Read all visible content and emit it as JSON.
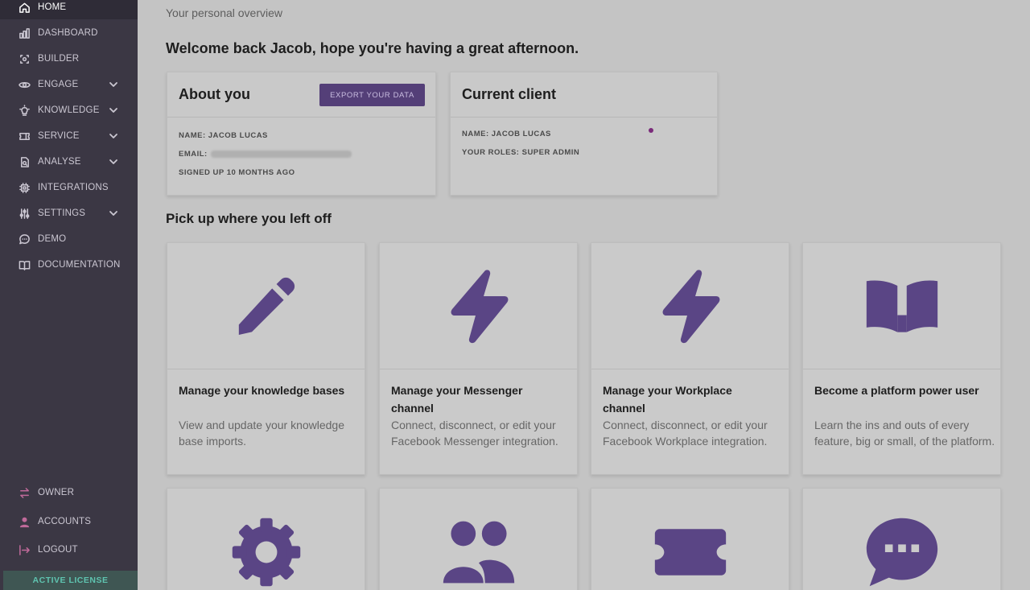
{
  "sidebar": {
    "items": [
      {
        "label": "HOME",
        "icon": "home-icon",
        "active": true
      },
      {
        "label": "DASHBOARD",
        "icon": "bar-chart-icon"
      },
      {
        "label": "BUILDER",
        "icon": "builder-icon"
      },
      {
        "label": "ENGAGE",
        "icon": "eye-icon",
        "expandable": true
      },
      {
        "label": "KNOWLEDGE",
        "icon": "lightbulb-icon",
        "expandable": true
      },
      {
        "label": "SERVICE",
        "icon": "ticket-icon",
        "expandable": true
      },
      {
        "label": "ANALYSE",
        "icon": "analyse-icon",
        "expandable": true
      },
      {
        "label": "INTEGRATIONS",
        "icon": "chip-icon"
      },
      {
        "label": "SETTINGS",
        "icon": "sliders-icon",
        "expandable": true
      },
      {
        "label": "DEMO",
        "icon": "chat-icon"
      },
      {
        "label": "DOCUMENTATION",
        "icon": "book-icon"
      }
    ],
    "bottom_items": [
      {
        "label": "OWNER",
        "icon": "swap-icon"
      },
      {
        "label": "ACCOUNTS",
        "icon": "user-icon"
      },
      {
        "label": "LOGOUT",
        "icon": "logout-icon"
      }
    ],
    "license": "ACTIVE LICENSE"
  },
  "main": {
    "subtitle": "Your personal overview",
    "welcome": "Welcome back Jacob, hope you're having a great afternoon.",
    "about": {
      "title": "About you",
      "export_label": "EXPORT YOUR DATA",
      "name": "NAME: JACOB LUCAS",
      "email_label": "EMAIL:",
      "signed_up": "SIGNED UP 10 MONTHS AGO"
    },
    "client": {
      "title": "Current client",
      "name": "NAME: JACOB LUCAS",
      "roles": "YOUR ROLES: SUPER ADMIN"
    },
    "section_title": "Pick up where you left off",
    "tiles": [
      {
        "icon": "pencil-icon",
        "title": "Manage your knowledge bases",
        "desc": "View and update your knowledge base imports."
      },
      {
        "icon": "lightning-icon",
        "title": "Manage your Messenger channel",
        "desc": "Connect, disconnect, or edit your Facebook Messenger integration."
      },
      {
        "icon": "lightning-icon",
        "title": "Manage your Workplace channel",
        "desc": "Connect, disconnect, or edit your Facebook Workplace integration."
      },
      {
        "icon": "open-book-icon",
        "title": "Become a platform power user",
        "desc": "Learn the ins and outs of every feature, big or small, of the platform."
      }
    ],
    "tiles_row2_icons": [
      "gear-icon",
      "users-icon",
      "ticket-icon",
      "chat-bubble-icon"
    ]
  },
  "colors": {
    "sidebar_bg": "#3b3744",
    "accent": "#5a4585",
    "license_text": "#5fc4b0",
    "bottom_icon": "#c06a9a"
  }
}
